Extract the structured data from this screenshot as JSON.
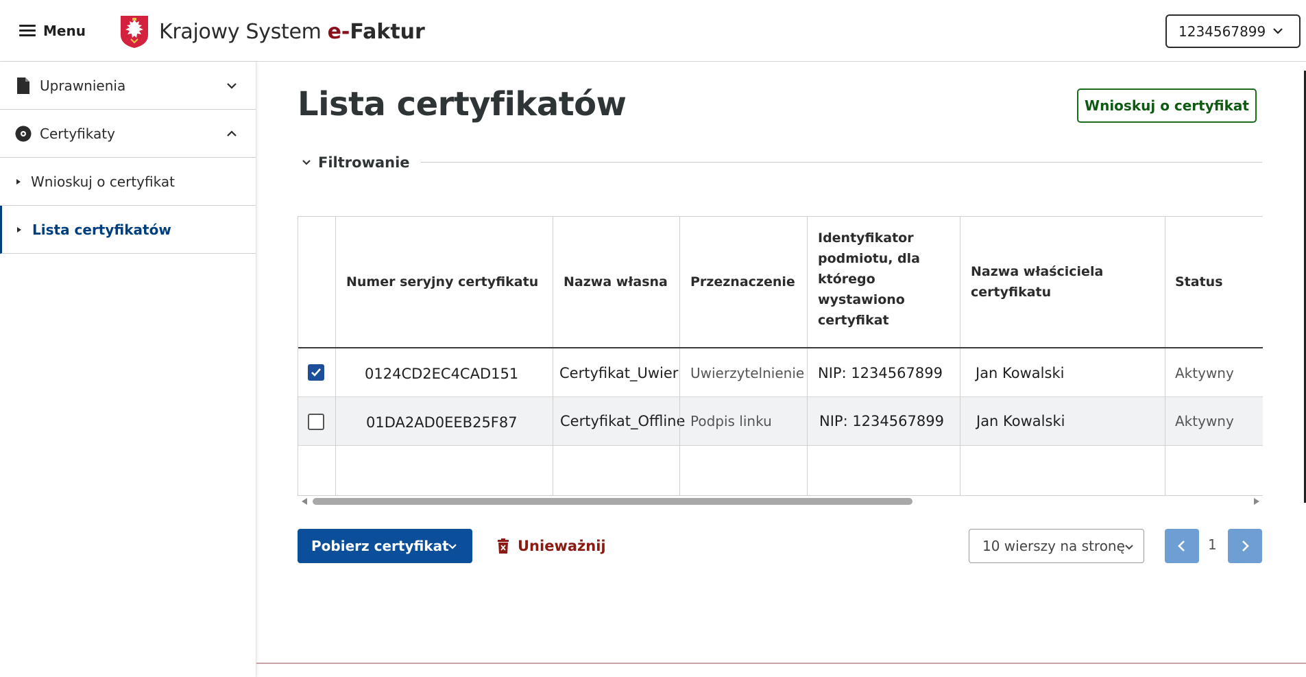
{
  "header": {
    "menu_label": "Menu",
    "brand_part1": "Krajowy System",
    "brand_part2": "e-",
    "brand_part3": "Faktur",
    "nip_value": "1234567899"
  },
  "sidebar": {
    "items": [
      {
        "label": "Uprawnienia",
        "icon": "document-icon",
        "state": "collapsed"
      },
      {
        "label": "Certyfikaty",
        "icon": "certificate-icon",
        "state": "expanded"
      },
      {
        "label": "Wnioskuj o certyfikat"
      },
      {
        "label": "Lista certyfikatów",
        "active": true
      }
    ]
  },
  "main": {
    "title": "Lista certyfikatów",
    "request_button": "Wnioskuj o certyfikat",
    "filter_label": "Filtrowanie"
  },
  "table": {
    "headers": [
      "Numer seryjny certyfikatu",
      "Nazwa własna",
      "Przeznaczenie",
      "Identyfikator podmiotu, dla którego wystawiono certyfikat",
      "Nazwa właściciela certyfikatu",
      "Status"
    ],
    "header_lines": {
      "identyfikator": [
        "Identyfikator",
        "podmiotu, dla",
        "którego",
        "wystawiono",
        "certyfikat"
      ],
      "wlasciciel": [
        "Nazwa właściciela",
        "certyfikatu"
      ]
    },
    "rows": [
      {
        "checked": true,
        "serial": "0124CD2EC4CAD151",
        "name": "Certyfikat_Uwier",
        "purpose": "Uwierzytelnienie",
        "subject": "NIP: 1234567899",
        "owner": "Jan Kowalski",
        "status": "Aktywny"
      },
      {
        "checked": false,
        "serial": "01DA2AD0EEB25F87",
        "name": "Certyfikat_Offline",
        "purpose": "Podpis linku",
        "subject": "NIP: 1234567899",
        "owner": "Jan Kowalski",
        "status": "Aktywny"
      }
    ]
  },
  "actions": {
    "download_label": "Pobierz certyfikat",
    "revoke_label": "Unieważnij",
    "rows_per_page": "10 wierszy na stronę",
    "current_page": "1"
  },
  "colors": {
    "primary": "#0b4e9a",
    "success_outline": "#1c6b1f",
    "danger": "#8a1a12",
    "brand_red": "#8a0f1b",
    "pager": "#6f9ed4"
  }
}
